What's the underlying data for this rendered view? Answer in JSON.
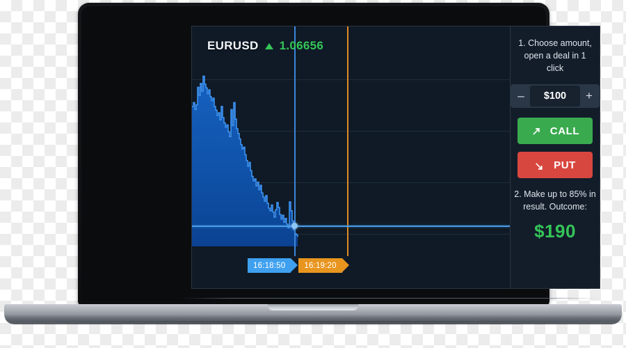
{
  "app": {
    "chart": {
      "ticker_symbol": "EURUSD",
      "direction_icon": "triangle-up-icon",
      "price": "1.06656",
      "price_color": "#35c558",
      "entry_time_label": "16:18:50",
      "expiry_time_label": "16:19:20",
      "entry_marker_color": "#3fa0ef",
      "expiry_marker_color": "#e8951f"
    },
    "panel": {
      "step1_text": "1. Choose amount, open a deal in 1 click",
      "decrease_label": "–",
      "amount_value": "$100",
      "increase_label": "+",
      "call_label": "CALL",
      "call_icon": "arrow-up-right-icon",
      "call_color": "#3aaa4f",
      "put_label": "PUT",
      "put_icon": "arrow-down-right-icon",
      "put_color": "#d8473f",
      "step2_text": "2. Make up to 85% in result. Outcome:",
      "outcome_value": "$190",
      "outcome_color": "#35c558"
    }
  },
  "chart_data": {
    "type": "area",
    "title": "EURUSD",
    "xlabel": "",
    "ylabel": "",
    "grid": true,
    "legend": false,
    "series": [
      {
        "name": "EURUSD",
        "line_color": "#2f8ae0",
        "fill_color": "#11529f",
        "values": [
          1.067,
          1.06712,
          1.0669,
          1.06705,
          1.0676,
          1.06735,
          1.06772,
          1.06748,
          1.06795,
          1.0677,
          1.06758,
          1.0674,
          1.06752,
          1.0673,
          1.06718,
          1.06726,
          1.067,
          1.06688,
          1.06672,
          1.0668,
          1.06658,
          1.067,
          1.06665,
          1.06648,
          1.06635,
          1.06642,
          1.0662,
          1.06605,
          1.0669,
          1.0664,
          1.06712,
          1.0666,
          1.0663,
          1.06615,
          1.06598,
          1.0658,
          1.06566,
          1.06572,
          1.06548,
          1.0653,
          1.06512,
          1.06524,
          1.06498,
          1.0648,
          1.06466,
          1.06472,
          1.0645,
          1.06462,
          1.06438,
          1.06452,
          1.06428,
          1.06415,
          1.06402,
          1.0642,
          1.06396,
          1.0638,
          1.06372,
          1.0639,
          1.06368,
          1.06352,
          1.06375,
          1.06398,
          1.06382,
          1.0636,
          1.06346,
          1.06358,
          1.06336,
          1.06348,
          1.0633,
          1.06318,
          1.064,
          1.06372,
          1.0634,
          1.06312,
          1.063,
          1.06296,
          1.0629
        ]
      }
    ],
    "horizontal_price_line": 1.06656,
    "vertical_markers": [
      {
        "label": "16:18:50",
        "type": "entry",
        "color": "#3d86d8"
      },
      {
        "label": "16:19:20",
        "type": "expiry",
        "color": "#e08b22"
      }
    ],
    "gridline_count": 4,
    "ylim": [
      1.0626,
      1.0682
    ]
  }
}
